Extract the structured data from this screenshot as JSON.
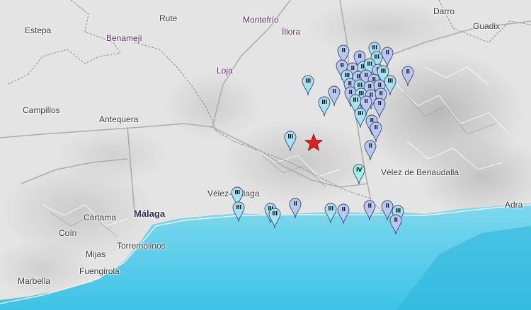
{
  "places": [
    {
      "id": "estepa",
      "label": "Estepa"
    },
    {
      "id": "rute",
      "label": "Rute"
    },
    {
      "id": "benameji",
      "label": "Benamejí"
    },
    {
      "id": "montefrio",
      "label": "Montefrío"
    },
    {
      "id": "illora",
      "label": "Íllora"
    },
    {
      "id": "darro",
      "label": "Darro"
    },
    {
      "id": "guadix",
      "label": "Guadix"
    },
    {
      "id": "loja",
      "label": "Loja"
    },
    {
      "id": "campillos",
      "label": "Campillos"
    },
    {
      "id": "antequera",
      "label": "Antequera"
    },
    {
      "id": "velez-benaudalla",
      "label": "Vélez de Benaudalla"
    },
    {
      "id": "velez-malaga",
      "label": "Vélez-Málaga"
    },
    {
      "id": "cartama",
      "label": "Cártama"
    },
    {
      "id": "malaga",
      "label": "Málaga"
    },
    {
      "id": "coin",
      "label": "Coín"
    },
    {
      "id": "torremolinos",
      "label": "Torremolinos"
    },
    {
      "id": "mijas",
      "label": "Mijas"
    },
    {
      "id": "fuengirola",
      "label": "Fuengirola"
    },
    {
      "id": "marbella",
      "label": "Marbella"
    },
    {
      "id": "adra",
      "label": "Adra"
    }
  ],
  "intensity_colors": {
    "II": "#b9c8f2",
    "III": "#a7e2f2",
    "IV": "#9ff2e6"
  },
  "epicenter": {
    "symbol": "star",
    "color": "#e02020"
  },
  "reports": [
    {
      "level": "II"
    },
    {
      "level": "III"
    },
    {
      "level": "II"
    },
    {
      "level": "II"
    },
    {
      "level": "III"
    },
    {
      "level": "II"
    },
    {
      "level": "II"
    },
    {
      "level": "III"
    },
    {
      "level": "III"
    },
    {
      "level": "II"
    },
    {
      "level": "III"
    },
    {
      "level": "II"
    },
    {
      "level": "II"
    },
    {
      "level": "II"
    },
    {
      "level": "III"
    },
    {
      "level": "II"
    },
    {
      "level": "III"
    },
    {
      "level": "II"
    },
    {
      "level": "II"
    },
    {
      "level": "III"
    },
    {
      "level": "II"
    },
    {
      "level": "III"
    },
    {
      "level": "II"
    },
    {
      "level": "II"
    },
    {
      "level": "II"
    },
    {
      "level": "III"
    },
    {
      "level": "II"
    },
    {
      "level": "II"
    },
    {
      "level": "III"
    },
    {
      "level": "II"
    },
    {
      "level": "II"
    },
    {
      "level": "III"
    },
    {
      "level": "II"
    },
    {
      "level": "IV"
    },
    {
      "level": "II"
    },
    {
      "level": "III"
    },
    {
      "level": "III"
    },
    {
      "level": "III"
    },
    {
      "level": "III"
    },
    {
      "level": "III"
    },
    {
      "level": "III"
    },
    {
      "level": "II"
    },
    {
      "level": "III"
    },
    {
      "level": "II"
    },
    {
      "level": "II"
    },
    {
      "level": "II"
    },
    {
      "level": "III"
    },
    {
      "level": "II"
    }
  ]
}
